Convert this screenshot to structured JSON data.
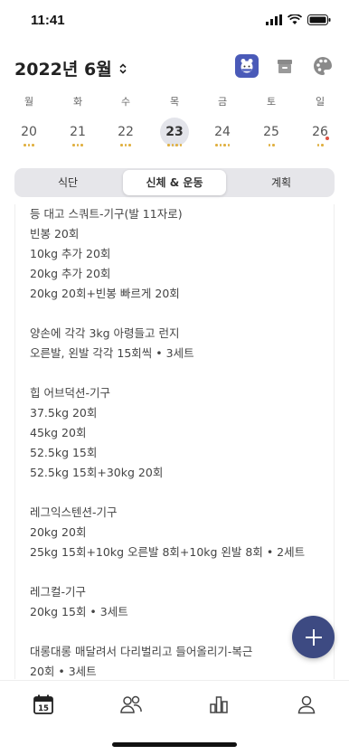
{
  "status": {
    "time": "11:41"
  },
  "header": {
    "month_title": "2022년 6월"
  },
  "week": {
    "days": [
      {
        "name": "월",
        "num": "20"
      },
      {
        "name": "화",
        "num": "21"
      },
      {
        "name": "수",
        "num": "22"
      },
      {
        "name": "목",
        "num": "23"
      },
      {
        "name": "금",
        "num": "24"
      },
      {
        "name": "토",
        "num": "25"
      },
      {
        "name": "일",
        "num": "26"
      }
    ],
    "selected_index": 3
  },
  "tabs": [
    {
      "label": "식단"
    },
    {
      "label": "신체 & 운동"
    },
    {
      "label": "계획"
    }
  ],
  "active_tab": 1,
  "content_lines": [
    "등 대고 스쿼트-기구(발 11자로)",
    "빈봉 20회",
    "10kg 추가 20회",
    "20kg 추가 20회",
    "20kg 20회+빈봉 빠르게 20회",
    "",
    "양손에 각각 3kg 아령들고 런지",
    "오른발, 왼발 각각 15회씩 • 3세트",
    "",
    "힙 어브덕션-기구",
    "37.5kg 20회",
    "45kg 20회",
    "52.5kg 15회",
    "52.5kg 15회+30kg 20회",
    "",
    "레그익스텐션-기구",
    "20kg 20회",
    "25kg 15회+10kg 오른발 8회+10kg 왼발 8회 • 2세트",
    "",
    "레그컬-기구",
    "20kg 15회 • 3세트",
    "",
    "대롱대롱 매달려서 다리벌리고 들어올리기-복근",
    "20회 • 3세트"
  ],
  "tabbar": {
    "calendar_day": "15"
  },
  "colors": {
    "accent": "#3d4a82",
    "dot_yellow": "#e0b040",
    "dot_red": "#e05040"
  }
}
